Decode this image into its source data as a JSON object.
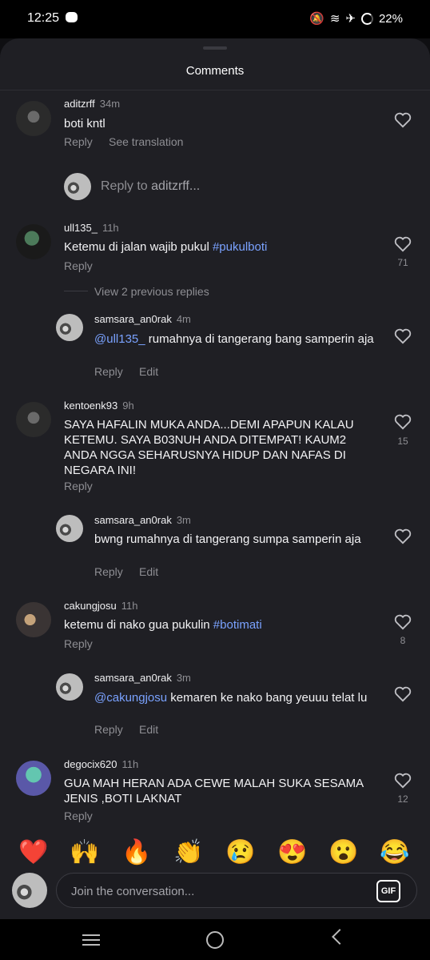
{
  "status": {
    "time": "12:25",
    "battery": "22%"
  },
  "header": {
    "title": "Comments"
  },
  "comments": [
    {
      "username": "aditzrff",
      "time": "34m",
      "text": "boti kntl",
      "actions": [
        "Reply",
        "See translation"
      ]
    },
    {
      "username": "ull135_",
      "time": "11h",
      "text_prefix": "Ketemu di jalan wajib pukul ",
      "hashtag": "#pukulboti",
      "likes": "71",
      "action": "Reply",
      "view_prev": "View 2 previous replies",
      "reply": {
        "username": "samsara_an0rak",
        "time": "4m",
        "mention": "@ull135_",
        "text": " rumahnya di tangerang bang samperin aja",
        "actions": [
          "Reply",
          "Edit"
        ]
      }
    },
    {
      "username": "kentoenk93",
      "time": "9h",
      "text": "SAYA HAFALIN MUKA ANDA...DEMI APAPUN KALAU KETEMU. SAYA B03NUH ANDA DITEMPAT! KAUM2 ANDA NGGA SEHARUSNYA HIDUP DAN NAFAS DI NEGARA INI!",
      "likes": "15",
      "action": "Reply",
      "reply": {
        "username": "samsara_an0rak",
        "time": "3m",
        "text": "bwng rumahnya di tangerang sumpa samperin aja",
        "actions": [
          "Reply",
          "Edit"
        ]
      }
    },
    {
      "username": "cakungjosu",
      "time": "11h",
      "text_prefix": "ketemu di nako gua pukulin ",
      "hashtag": "#botimati",
      "likes": "8",
      "action": "Reply",
      "reply": {
        "username": "samsara_an0rak",
        "time": "3m",
        "mention": "@cakungjosu",
        "text": " kemaren ke nako bang yeuuu telat lu",
        "actions": [
          "Reply",
          "Edit"
        ]
      }
    },
    {
      "username": "degocix620",
      "time": "11h",
      "text": "GUA MAH HERAN ADA CEWE MALAH SUKA SESAMA JENIS ,BOTI LAKNAT",
      "likes": "12",
      "action": "Reply"
    }
  ],
  "reply_to": {
    "prefix": "Reply to ",
    "name": "aditzrff..."
  },
  "emojis": [
    "❤️",
    "🙌",
    "🔥",
    "👏",
    "😢",
    "😍",
    "😮",
    "😂"
  ],
  "composer": {
    "placeholder": "Join the conversation...",
    "gif_label": "GIF"
  }
}
